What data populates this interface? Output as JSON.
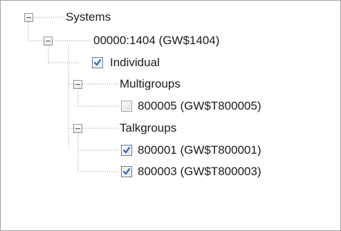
{
  "tree": {
    "root": {
      "label": "Systems",
      "expanded": true,
      "children": {
        "system": {
          "label": "00000:1404 (GW$1404)",
          "expanded": true,
          "individual": {
            "label": "Individual",
            "checked": true
          },
          "multigroups": {
            "label": "Multigroups",
            "expanded": true,
            "items": [
              {
                "label": "800005 (GW$T800005)",
                "checked": false
              }
            ]
          },
          "talkgroups": {
            "label": "Talkgroups",
            "expanded": true,
            "items": [
              {
                "label": "800001 (GW$T800001)",
                "checked": true
              },
              {
                "label": "800003 (GW$T800003)",
                "checked": true
              }
            ]
          }
        }
      }
    }
  },
  "colors": {
    "border": "#a0a0a0",
    "check_mark": "#2b63c4",
    "tree_lines": "#8c8c8c",
    "text": "#1a1a1a"
  }
}
